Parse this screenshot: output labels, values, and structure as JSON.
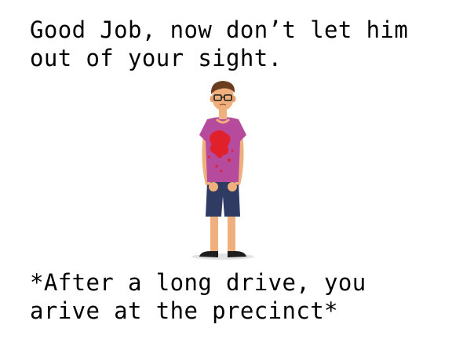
{
  "dialogue": {
    "line": "Good Job, now don’t let him out of your sight."
  },
  "narration": {
    "line": "*After a long drive, you arive at the precinct*"
  },
  "character": {
    "icon": "injured-man-character",
    "colors": {
      "shirt": "#b64a9d",
      "shorts": "#2f3b63",
      "skin": "#f0b07d",
      "hair": "#6b3d1f",
      "blood": "#e0202a",
      "shoes": "#1e1e1e"
    }
  }
}
